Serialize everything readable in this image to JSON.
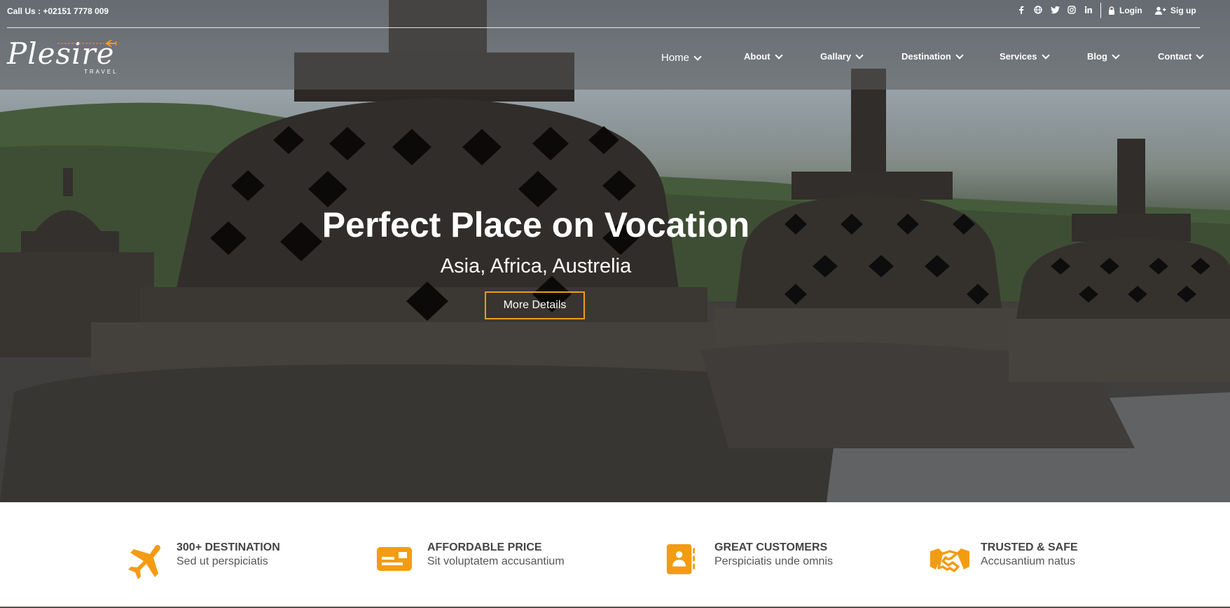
{
  "topbar": {
    "call_text": "Call Us : +02151 7778 009",
    "social_icons": [
      "facebook-icon",
      "globe-icon",
      "twitter-icon",
      "instagram-icon",
      "linkedin-icon"
    ],
    "login_label": "Login",
    "signup_label": "Sig up"
  },
  "logo": {
    "name": "Plesire",
    "tagline": "TRAVEL"
  },
  "nav": {
    "items": [
      {
        "label": "Home"
      },
      {
        "label": "About"
      },
      {
        "label": "Gallary"
      },
      {
        "label": "Destination"
      },
      {
        "label": "Services"
      },
      {
        "label": "Blog"
      },
      {
        "label": "Contact"
      }
    ]
  },
  "hero": {
    "title": "Perfect Place on Vocation",
    "subtitle": "Asia, Africa, Austrelia",
    "cta_label": "More Details"
  },
  "features": [
    {
      "icon": "airplane-icon",
      "title": "300+ DESTINATION",
      "desc": "Sed ut perspiciatis"
    },
    {
      "icon": "price-card-icon",
      "title": "AFFORDABLE PRICE",
      "desc": "Sit voluptatem accusantium"
    },
    {
      "icon": "customer-contact-icon",
      "title": "GREAT CUSTOMERS",
      "desc": "Perspiciatis unde omnis"
    },
    {
      "icon": "handshake-icon",
      "title": "TRUSTED & SAFE",
      "desc": "Accusantium natus"
    }
  ],
  "colors": {
    "accent": "#f39c12",
    "text_dark": "#444444",
    "white": "#ffffff"
  }
}
